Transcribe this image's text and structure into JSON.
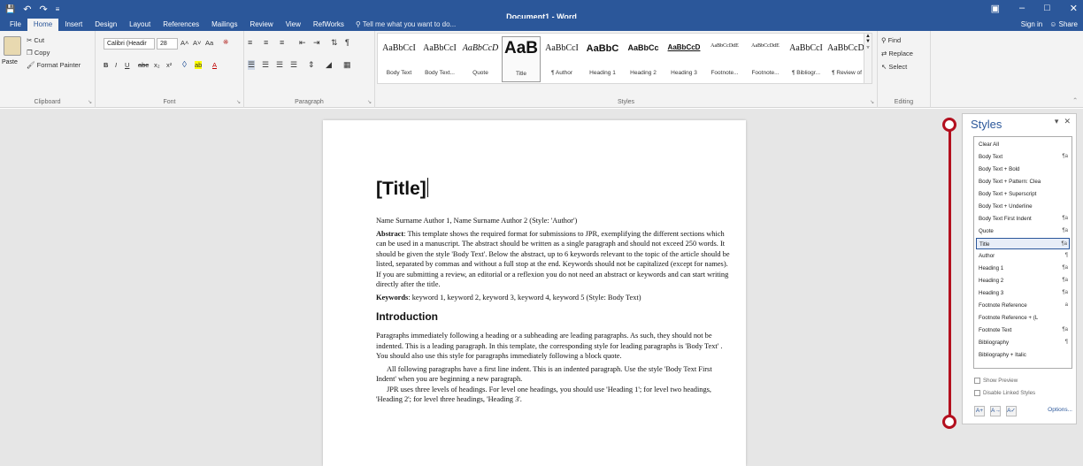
{
  "window": {
    "title": "Document1 - Word"
  },
  "qat": {
    "save_glyph": "💾",
    "undo_glyph": "↶",
    "redo_glyph": "↷",
    "more_glyph": "≡"
  },
  "window_controls": {
    "restore_glyph": "▣",
    "minimize_glyph": "–",
    "maximize_glyph": "□",
    "close_glyph": "✕"
  },
  "tabs": [
    "File",
    "Home",
    "Insert",
    "Design",
    "Layout",
    "References",
    "Mailings",
    "Review",
    "View",
    "RefWorks"
  ],
  "tell_me": "Tell me what you want to do...",
  "account": {
    "sign_in": "Sign in",
    "share": "Share"
  },
  "clipboard": {
    "paste": "Paste",
    "cut": "Cut",
    "copy": "Copy",
    "format_painter": "Format Painter",
    "label": "Clipboard"
  },
  "font": {
    "name": "Calibri (Headir",
    "size": "28",
    "label": "Font",
    "bold": "B",
    "italic": "I",
    "underline": "U",
    "strike": "abc",
    "sub": "x₂",
    "sup": "x²",
    "grow": "A˄",
    "shrink": "A˅",
    "case": "Aa",
    "highlight": "ab",
    "color": "A"
  },
  "paragraph": {
    "label": "Paragraph"
  },
  "styles_gallery": {
    "label": "Styles",
    "items": [
      {
        "preview": "AaBbCcI",
        "name": "Body Text"
      },
      {
        "preview": "AaBbCcI",
        "name": "Body Text..."
      },
      {
        "preview": "AaBbCcD",
        "name": "Quote"
      },
      {
        "preview": "AaB",
        "name": "Title"
      },
      {
        "preview": "AaBbCcI",
        "name": "¶ Author"
      },
      {
        "preview": "AaBbC",
        "name": "Heading 1"
      },
      {
        "preview": "AaBbCc",
        "name": "Heading 2"
      },
      {
        "preview": "AaBbCcD",
        "name": "Heading 3"
      },
      {
        "preview": "AaBbCcDdE",
        "name": "Footnote..."
      },
      {
        "preview": "AaBbCcDdE",
        "name": "Footnote..."
      },
      {
        "preview": "AaBbCcI",
        "name": "¶ Bibliogr..."
      },
      {
        "preview": "AaBbCcDc",
        "name": "¶ Review of"
      }
    ]
  },
  "editing": {
    "find": "Find",
    "replace": "Replace",
    "select": "Select",
    "label": "Editing"
  },
  "document": {
    "title": "[Title]",
    "authors": "Name Surname Author 1, Name Surname Author 2 (Style: 'Author')",
    "abstract_label": "Abstract",
    "abstract_text": ": This template shows the required format for submissions to JPR, exemplifying the different sections which can be used in a manuscript. The abstract should be written as a single paragraph and should not exceed 250 words. It should be given the style 'Body Text'. Below the abstract, up to 6 keywords relevant to the topic of the article should be listed, separated by commas and without a full stop at the end. Keywords should not be capitalized (except for names). If you are submitting a review, an editorial or a reflexion you do not need an abstract or keywords and can start writing directly after the title.",
    "keywords_label": "Keywords",
    "keywords_text": ": keyword 1, keyword 2, keyword 3, keyword 4, keyword 5 (Style: Body Text)",
    "heading": "Introduction",
    "para1": "Paragraphs immediately following a heading or a subheading are leading paragraphs. As such, they should not be indented. This is a leading paragraph. In this template, the corresponding style for leading paragraphs is 'Body Text' . You should also use this style for paragraphs immediately following a block quote.",
    "para2": "All following paragraphs have a first line indent. This is an indented paragraph. Use the style 'Body Text First Indent' when you are beginning a new paragraph.",
    "para3": "JPR uses three levels of headings. For level one headings, you should use 'Heading 1'; for level two headings, 'Heading 2'; for level three headings, 'Heading 3'."
  },
  "styles_pane": {
    "title": "Styles",
    "styles": [
      {
        "name": "Clear All",
        "mark": ""
      },
      {
        "name": "Body Text",
        "mark": "¶a"
      },
      {
        "name": "Body Text + Bold",
        "mark": ""
      },
      {
        "name": "Body Text + Pattern: Clea",
        "mark": ""
      },
      {
        "name": "Body Text + Superscript",
        "mark": ""
      },
      {
        "name": "Body Text + Underline",
        "mark": ""
      },
      {
        "name": "Body Text First Indent",
        "mark": "¶a"
      },
      {
        "name": "Quote",
        "mark": "¶a"
      },
      {
        "name": "Title",
        "mark": "¶a"
      },
      {
        "name": "Author",
        "mark": "¶"
      },
      {
        "name": "Heading 1",
        "mark": "¶a"
      },
      {
        "name": "Heading 2",
        "mark": "¶a"
      },
      {
        "name": "Heading 3",
        "mark": "¶a"
      },
      {
        "name": "Footnote Reference",
        "mark": "a"
      },
      {
        "name": "Footnote Reference + (L",
        "mark": ""
      },
      {
        "name": "Footnote Text",
        "mark": "¶a"
      },
      {
        "name": "Bibliography",
        "mark": "¶"
      },
      {
        "name": "Bibliography + Italic",
        "mark": ""
      }
    ],
    "selected": "Title",
    "show_preview": "Show Preview",
    "disable_linked": "Disable Linked Styles",
    "options": "Options...",
    "new_style_glyph": "A+",
    "inspector_glyph": "A→",
    "manage_glyph": "A✓"
  },
  "colors": {
    "accent": "#2b579a",
    "highlight_annotation": "#b30f1e"
  }
}
